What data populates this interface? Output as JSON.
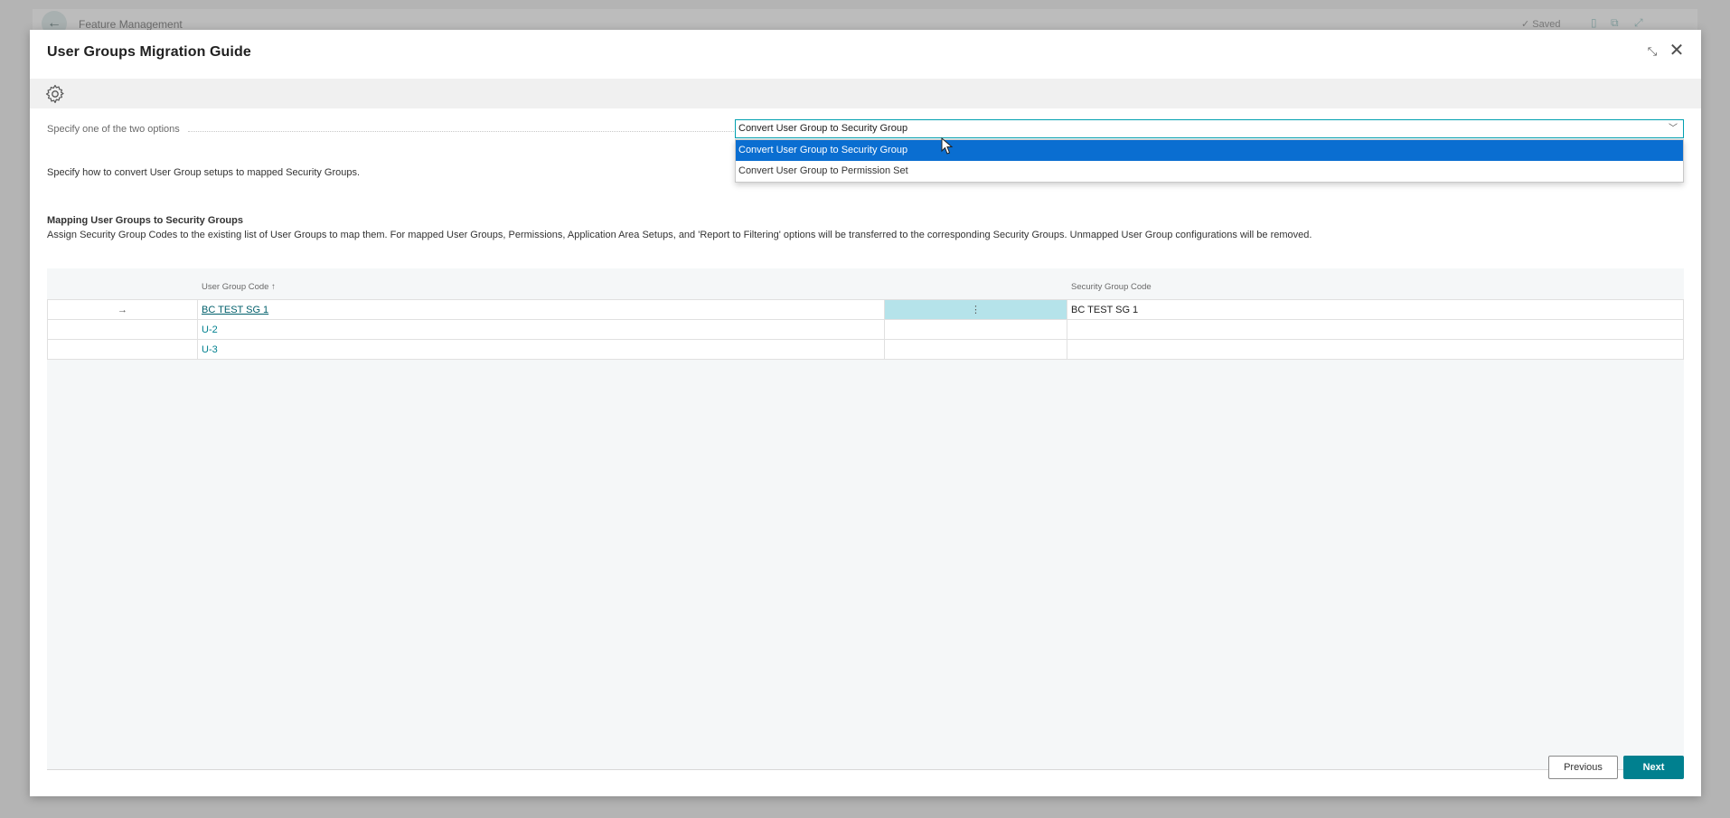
{
  "background": {
    "page_title": "Feature Management",
    "saved_label": "✓ Saved"
  },
  "dialog": {
    "title": "User Groups Migration Guide",
    "options": {
      "label": "Specify one of the two options",
      "selected": "Convert User Group to Security Group",
      "choices": [
        "Convert User Group to Security Group",
        "Convert User Group to Permission Set"
      ]
    },
    "instruction": "Specify how to convert User Group setups to mapped Security Groups.",
    "mapping": {
      "title": "Mapping User Groups to Security Groups",
      "description": "Assign Security Group Codes to the existing list of User Groups to map them. For mapped User Groups, Permissions, Application Area Setups, and 'Report to Filtering' options will be transferred to the corresponding Security Groups. Unmapped User Group configurations will be removed.",
      "columns": {
        "user_group_code": "User Group Code ↑",
        "security_group_code": "Security Group Code"
      },
      "rows": [
        {
          "indicator": "→",
          "user_group_code": "BC TEST SG 1",
          "menu": "⋮",
          "security_group_code": "BC TEST SG 1"
        },
        {
          "indicator": "",
          "user_group_code": "U-2",
          "menu": "",
          "security_group_code": ""
        },
        {
          "indicator": "",
          "user_group_code": "U-3",
          "menu": "",
          "security_group_code": ""
        }
      ]
    },
    "buttons": {
      "previous": "Previous",
      "next": "Next"
    }
  },
  "colors": {
    "accent": "#00808f",
    "selection": "#0a6ed1",
    "active_cell": "#b5e3ea"
  }
}
